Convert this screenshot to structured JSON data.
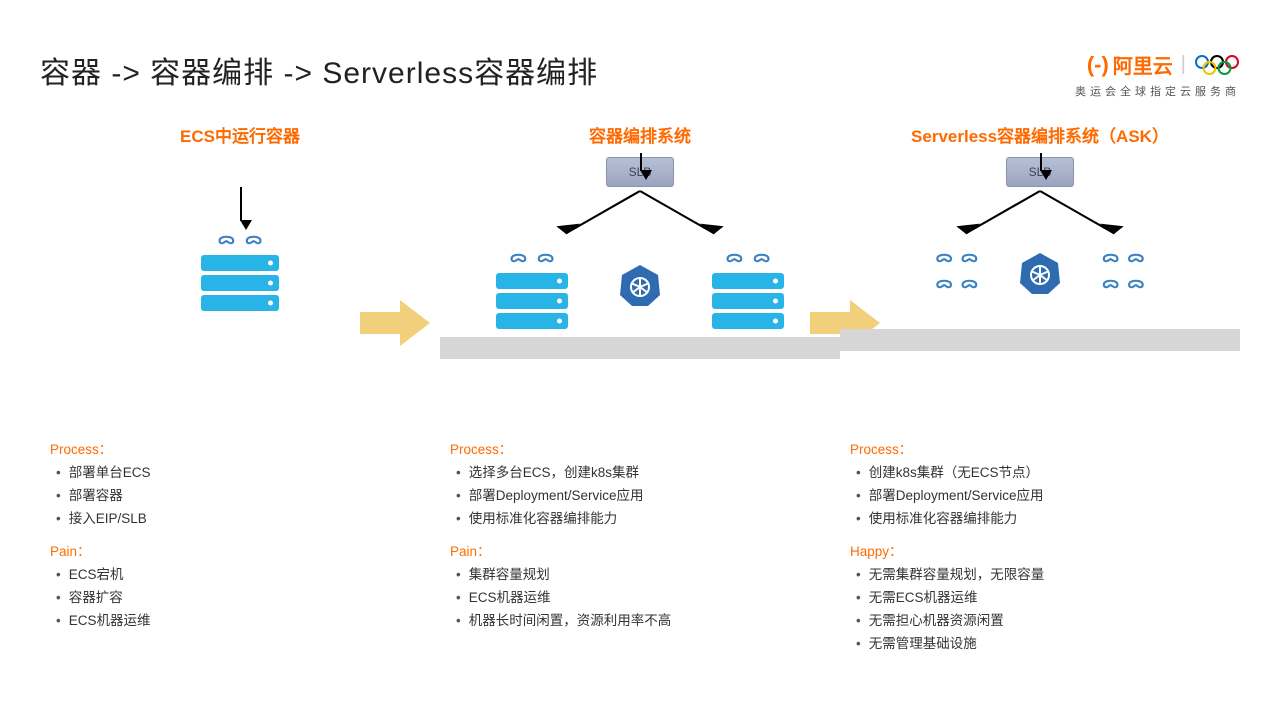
{
  "title": "容器 -> 容器编排 -> Serverless容器编排",
  "brand": {
    "name": "阿里云",
    "sub": "奥运会全球指定云服务商"
  },
  "slb_label": "SLB",
  "columns": [
    {
      "title": "ECS中运行容器",
      "process_title": "Process：",
      "process": [
        "部署单台ECS",
        "部署容器",
        "接入EIP/SLB"
      ],
      "pain_title": "Pain：",
      "pain": [
        "ECS宕机",
        "容器扩容",
        "ECS机器运维"
      ]
    },
    {
      "title": "容器编排系统",
      "process_title": "Process：",
      "process": [
        "选择多台ECS，创建k8s集群",
        "部署Deployment/Service应用",
        "使用标准化容器编排能力"
      ],
      "pain_title": "Pain：",
      "pain": [
        "集群容量规划",
        "ECS机器运维",
        "机器长时间闲置，资源利用率不高"
      ]
    },
    {
      "title": "Serverless容器编排系统（ASK）",
      "process_title": "Process：",
      "process": [
        "创建k8s集群（无ECS节点）",
        "部署Deployment/Service应用",
        "使用标准化容器编排能力"
      ],
      "happy_title": "Happy：",
      "happy": [
        "无需集群容量规划，无限容量",
        "无需ECS机器运维",
        "无需担心机器资源闲置",
        "无需管理基础设施"
      ]
    }
  ]
}
